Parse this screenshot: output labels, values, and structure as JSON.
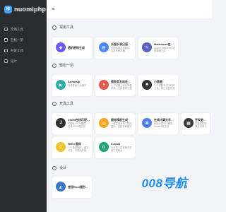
{
  "app": {
    "logo_text": "nuomiphp",
    "logo_mark": "❄"
  },
  "topbar": {
    "menu_icon": "≡"
  },
  "sidebar": {
    "items": [
      {
        "label": "常用工具"
      },
      {
        "label": "轻松一刻"
      },
      {
        "label": "开发工具"
      },
      {
        "label": "设计"
      }
    ]
  },
  "sections": [
    {
      "title": "常用工具",
      "cards": [
        {
          "title": "随机密码生成",
          "desc": "",
          "icon_color": "#6a5af9",
          "icon_glyph": "◆"
        },
        {
          "title": "长图水滴日报制作",
          "desc": "长图水滴日报制作，支持多种风格",
          "icon_color": "#4a86f7",
          "icon_glyph": "▤"
        },
        {
          "title": "Markdown在线编辑器",
          "desc": "Cherry Markdown 在线编辑工具",
          "icon_color": "#5a5fc6",
          "icon_glyph": "✎"
        }
      ]
    },
    {
      "title": "轻松一刻",
      "cards": [
        {
          "title": "Anbutalp",
          "desc": "在线视频小品娱乐",
          "icon_color": "#2bb0a8",
          "icon_glyph": "▶"
        },
        {
          "title": "摸鱼官方站在线观看云览",
          "desc": "上下班路上轻松观看资源，支持推荐分类",
          "icon_color": "#e25b4d",
          "icon_glyph": "●"
        },
        {
          "title": "小黑屋",
          "desc": "一个强制专注写作的工具，禁止返回改写",
          "icon_color": "#333333",
          "icon_glyph": "■"
        }
      ]
    },
    {
      "title": "开发工具",
      "cards": [
        {
          "title": "JSON在线可视化工具",
          "desc": "可视化JSON编辑、在线JSON格式化",
          "icon_color": "#2f2f2f",
          "icon_glyph": "J"
        },
        {
          "title": "图标模板生成",
          "desc": "一键生成多尺寸网站图标，支持多种格式",
          "icon_color": "#f6a723",
          "icon_glyph": "◎"
        },
        {
          "title": "在线计算文字解码方法",
          "desc": "在线计算文字解码，Base64等工具",
          "icon_color": "#4e7df2",
          "icon_glyph": "⌘"
        },
        {
          "title": "开发者速查",
          "desc": "开发者常用速查手册 汇总",
          "icon_color": "#3b3b3b",
          "icon_glyph": "▦"
        },
        {
          "title": "Hello 图床",
          "desc": "一个免费图床，稳定可靠，不限制外链",
          "icon_color": "#f4c430",
          "icon_glyph": "☺"
        },
        {
          "title": "it-tools",
          "desc": "为开发人员准备的在线工具集合",
          "icon_color": "#1ea672",
          "icon_glyph": "⚙"
        }
      ]
    },
    {
      "title": "设计",
      "cards": [
        {
          "title": "使用Root图形自动图形",
          "desc": "",
          "icon_color": "#3778c7",
          "icon_glyph": "◭"
        }
      ]
    }
  ],
  "watermark": {
    "text": "008导航"
  }
}
